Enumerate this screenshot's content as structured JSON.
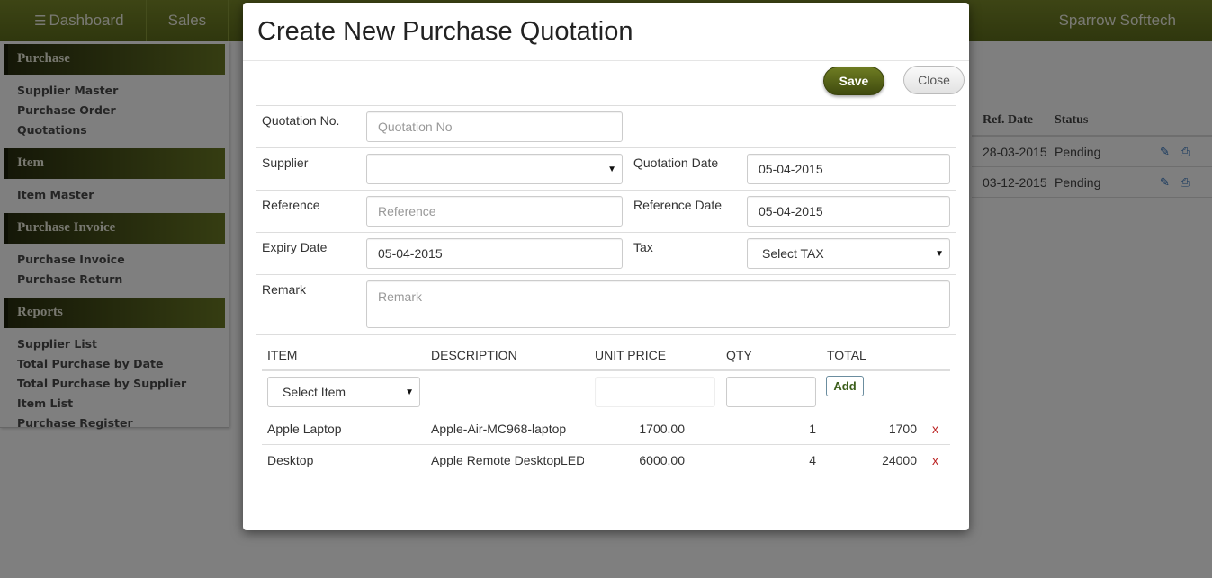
{
  "topnav": {
    "items": [
      {
        "label": "Dashboard",
        "icon": "list-icon"
      },
      {
        "label": "Sales"
      }
    ],
    "brand": "Sparrow Softtech"
  },
  "sidebar": {
    "sections": [
      {
        "title": "Purchase",
        "links": [
          "Supplier Master",
          "Purchase Order",
          "Quotations"
        ]
      },
      {
        "title": "Item",
        "links": [
          "Item Master"
        ]
      },
      {
        "title": "Purchase Invoice",
        "links": [
          "Purchase Invoice",
          "Purchase Return"
        ]
      },
      {
        "title": "Reports",
        "links": [
          "Supplier List",
          "Total Purchase by Date",
          "Total Purchase by Supplier",
          "Item List",
          "Purchase Register"
        ]
      }
    ]
  },
  "background_table": {
    "headers": {
      "ref_date": "Ref. Date",
      "status": "Status"
    },
    "rows": [
      {
        "ref_date": "28-03-2015",
        "status": "Pending"
      },
      {
        "ref_date": "03-12-2015",
        "status": "Pending"
      }
    ]
  },
  "modal": {
    "title": "Create New Purchase Quotation",
    "save_label": "Save",
    "close_label": "Close",
    "fields": {
      "quotation_no": {
        "label": "Quotation No.",
        "placeholder": "Quotation No"
      },
      "supplier": {
        "label": "Supplier",
        "value": ""
      },
      "quotation_date": {
        "label": "Quotation Date",
        "value": "05-04-2015"
      },
      "reference": {
        "label": "Reference",
        "placeholder": "Reference"
      },
      "reference_date": {
        "label": "Reference Date",
        "value": "05-04-2015"
      },
      "expiry_date": {
        "label": "Expiry Date",
        "value": "05-04-2015"
      },
      "tax": {
        "label": "Tax",
        "value": "Select TAX"
      },
      "remark": {
        "label": "Remark",
        "placeholder": "Remark"
      }
    },
    "items_table": {
      "headers": {
        "item": "ITEM",
        "description": "DESCRIPTION",
        "unit_price": "UNIT PRICE",
        "qty": "QTY",
        "total": "TOTAL"
      },
      "entry": {
        "item_select": "Select Item",
        "add_label": "Add"
      },
      "rows": [
        {
          "item": "Apple Laptop",
          "description": "Apple-Air-MC968-laptop",
          "unit_price": "1700.00",
          "qty": "1",
          "total": "1700",
          "remove": "x"
        },
        {
          "item": "Desktop",
          "description": "Apple Remote DesktopLED",
          "unit_price": "6000.00",
          "qty": "4",
          "total": "24000",
          "remove": "x"
        }
      ]
    }
  }
}
